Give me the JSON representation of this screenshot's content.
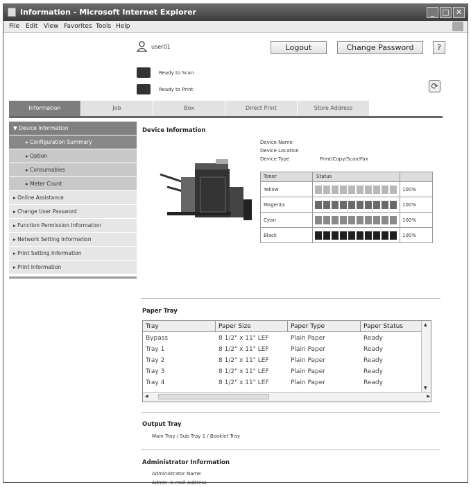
{
  "window": {
    "title": "Information - Microsoft Internet Explorer"
  },
  "menubar": [
    "File",
    "Edit",
    "View",
    "Favorites",
    "Tools",
    "Help"
  ],
  "header": {
    "user": "user01",
    "logout_label": "Logout",
    "change_password_label": "Change Password",
    "status_scan": "Ready to Scan",
    "status_print": "Ready to Print"
  },
  "tabs": [
    "Information",
    "Job",
    "Box",
    "Direct Print",
    "Store Address"
  ],
  "sidebar": [
    {
      "label": "Device Information",
      "level": "head"
    },
    {
      "label": "Configuration Summary",
      "level": "sub"
    },
    {
      "label": "Option",
      "level": "subl"
    },
    {
      "label": "Consumables",
      "level": "subl"
    },
    {
      "label": "Meter Count",
      "level": "subl"
    },
    {
      "label": "Online Assistance",
      "level": "top"
    },
    {
      "label": "Change User Password",
      "level": "top"
    },
    {
      "label": "Function Permission Information",
      "level": "top"
    },
    {
      "label": "Network Setting Information",
      "level": "top"
    },
    {
      "label": "Print Setting Information",
      "level": "top"
    },
    {
      "label": "Print Information",
      "level": "top"
    }
  ],
  "device_info": {
    "title": "Device Information",
    "name_label": "Device Name",
    "location_label": "Device Location",
    "type_label": "Device Type",
    "type_value": "Print/Copy/Scan/Fax",
    "toner_header": "Toner",
    "status_header": "Status",
    "toner": [
      {
        "name": "Yellow",
        "level": 1.0,
        "percent": "100%",
        "color": "#b8b8b8"
      },
      {
        "name": "Magenta",
        "level": 1.0,
        "percent": "100%",
        "color": "#6a6a6a"
      },
      {
        "name": "Cyan",
        "level": 1.0,
        "percent": "100%",
        "color": "#8a8a8a"
      },
      {
        "name": "Black",
        "level": 1.0,
        "percent": "100%",
        "color": "#1f1f1f"
      }
    ]
  },
  "paper_tray": {
    "title": "Paper Tray",
    "columns": [
      "Tray",
      "Paper Size",
      "Paper Type",
      "Paper Status"
    ],
    "rows": [
      [
        "Bypass",
        "8 1/2\" x 11\" LEF",
        "Plain Paper",
        "Ready"
      ],
      [
        "Tray 1",
        "8 1/2\" x 11\" LEF",
        "Plain Paper",
        "Ready"
      ],
      [
        "Tray 2",
        "8 1/2\" x 11\" LEF",
        "Plain Paper",
        "Ready"
      ],
      [
        "Tray 3",
        "8 1/2\" x 11\" LEF",
        "Plain Paper",
        "Ready"
      ],
      [
        "Tray 4",
        "8 1/2\" x 11\" LEF",
        "Plain Paper",
        "Ready"
      ]
    ]
  },
  "output_tray": {
    "title": "Output Tray",
    "value": "Main Tray / Sub Tray 1 / Booklet Tray"
  },
  "admin": {
    "title": "Administrator Information",
    "name_label": "Administrator Name",
    "email_label": "Admin. E-mail Address"
  }
}
